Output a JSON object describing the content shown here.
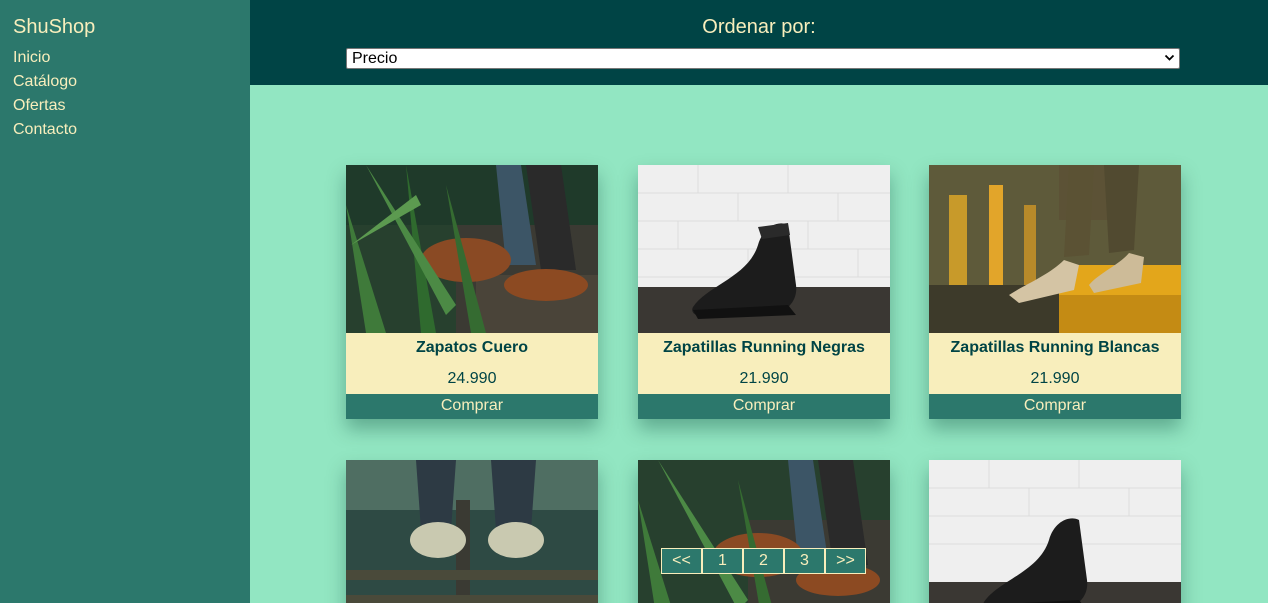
{
  "sidebar": {
    "brand": "ShuShop",
    "items": [
      {
        "label": "Inicio"
      },
      {
        "label": "Catálogo"
      },
      {
        "label": "Ofertas"
      },
      {
        "label": "Contacto"
      }
    ]
  },
  "header": {
    "sort_label": "Ordenar por:",
    "sort_selected": "Precio"
  },
  "products": [
    {
      "name": "Zapatos Cuero",
      "price": "24.990",
      "buy_label": "Comprar"
    },
    {
      "name": "Zapatillas Running Negras",
      "price": "21.990",
      "buy_label": "Comprar"
    },
    {
      "name": "Zapatillas Running Blancas",
      "price": "21.990",
      "buy_label": "Comprar"
    }
  ],
  "pagination": {
    "prev": "<<",
    "pages": [
      "1",
      "2",
      "3"
    ],
    "next": ">>"
  },
  "colors": {
    "sidebar": "#2c786c",
    "header": "#004445",
    "background": "#92e6c2",
    "cream": "#f8eebc"
  }
}
